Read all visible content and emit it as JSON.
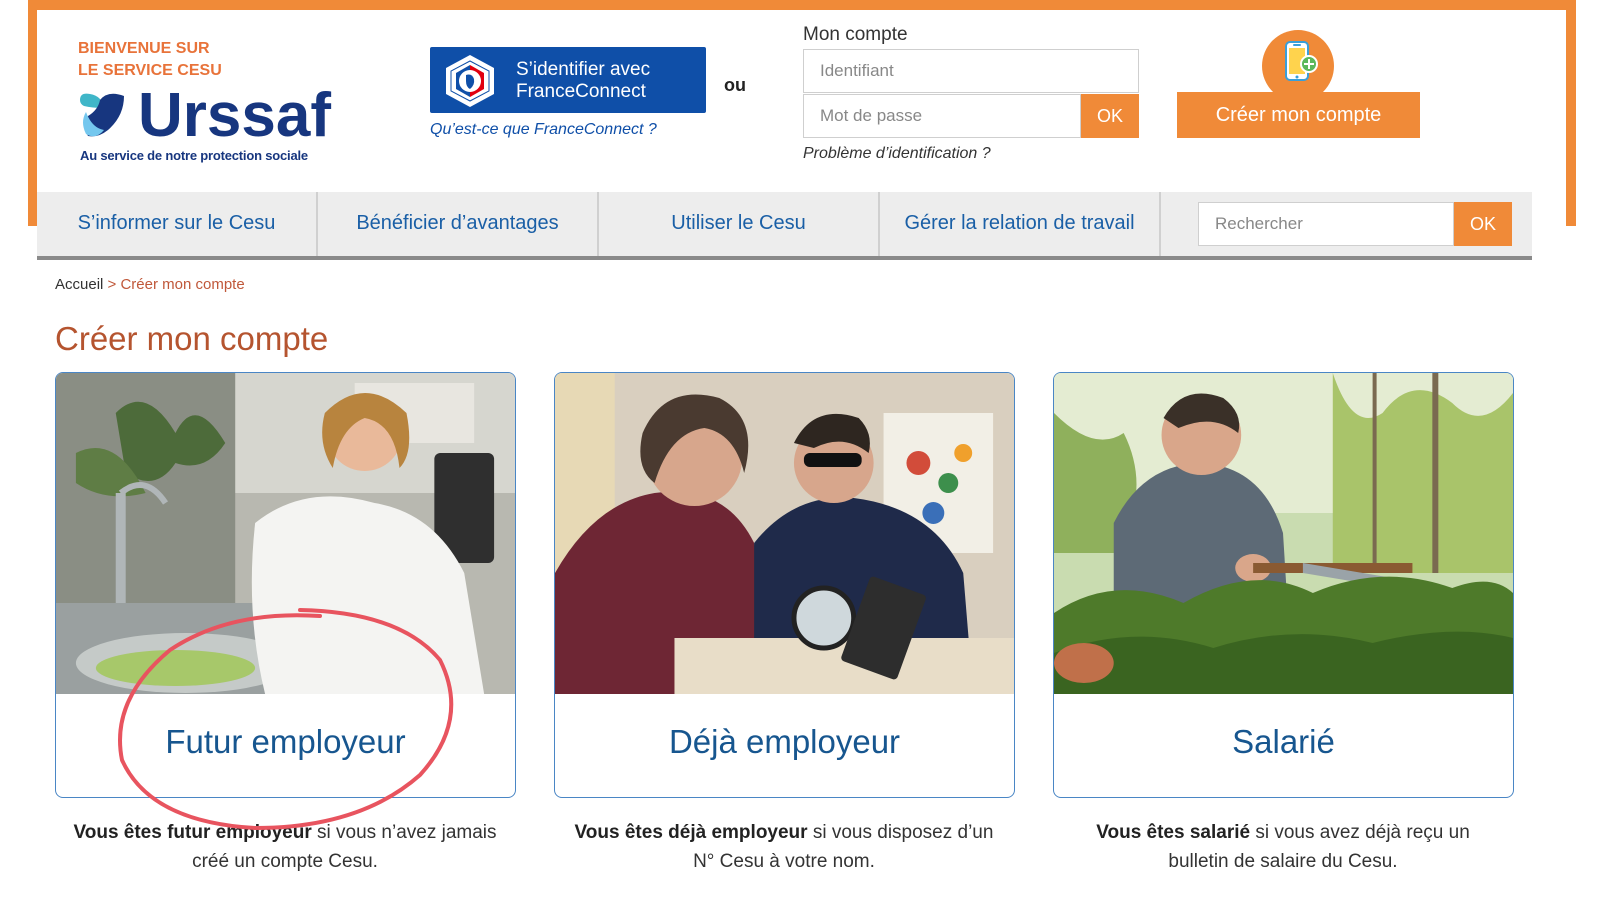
{
  "header": {
    "welcome_line1": "BIENVENUE SUR",
    "welcome_line2": "LE SERVICE CESU",
    "brand_name": "Urssaf",
    "brand_tagline": "Au service de notre protection sociale",
    "franceconnect": {
      "line1": "S’identifier avec",
      "line2": "FranceConnect",
      "help_link": "Qu’est-ce que FranceConnect ?"
    },
    "or_label": "ou",
    "login": {
      "title": "Mon compte",
      "identifier_placeholder": "Identifiant",
      "password_placeholder": "Mot de passe",
      "ok_label": "OK",
      "problem_link": "Problème d’identification ?"
    },
    "create_account_label": "Créer mon compte"
  },
  "nav": {
    "items": [
      {
        "label": "S’informer sur le Cesu"
      },
      {
        "label": "Bénéficier d’avantages"
      },
      {
        "label": "Utiliser le Cesu"
      },
      {
        "label": "Gérer la relation de travail"
      }
    ],
    "search_placeholder": "Rechercher",
    "search_ok": "OK"
  },
  "breadcrumb": {
    "home": "Accueil",
    "separator": ">",
    "current": "Créer mon compte"
  },
  "page_title": "Créer mon compte",
  "cards": [
    {
      "label": "Futur employeur",
      "desc_bold": "Vous êtes futur employeur",
      "desc_rest1": " si vous n’avez jamais",
      "desc_line2": "créé un compte Cesu."
    },
    {
      "label": "Déjà employeur",
      "desc_bold": "Vous êtes déjà employeur",
      "desc_rest1": " si vous disposez d’un",
      "desc_line2": "N° Cesu à votre nom."
    },
    {
      "label": "Salarié",
      "desc_bold": "Vous êtes salarié",
      "desc_rest1": " si vous avez déjà reçu un",
      "desc_line2": "bulletin de salaire du Cesu."
    }
  ],
  "colors": {
    "accent_orange": "#f08a38",
    "brand_blue": "#17367f",
    "link_blue": "#1a5fa6",
    "title_rust": "#b5542f",
    "annotation_red": "#e8545f"
  },
  "icons": {
    "phone_add": "phone-plus-icon",
    "franceconnect": "marianne-emblem-icon"
  }
}
